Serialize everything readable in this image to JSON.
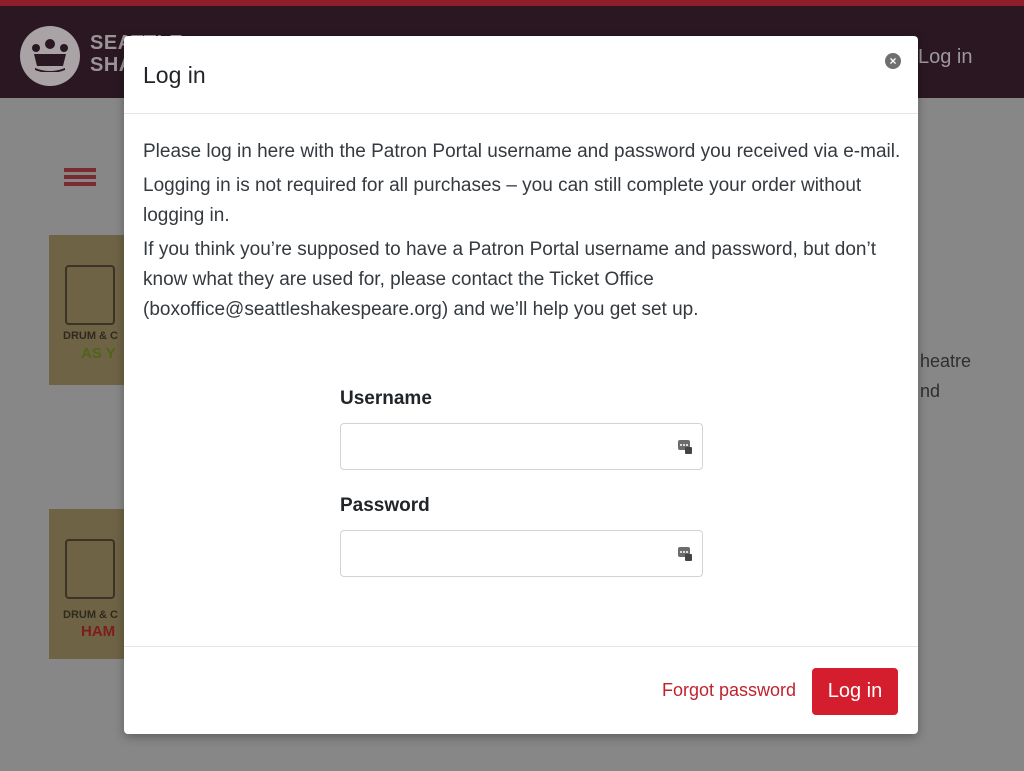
{
  "header": {
    "brand_line1": "SEATTLE",
    "brand_line2": "SHAKESPEARE",
    "login_link": "Log in"
  },
  "background": {
    "posters": [
      {
        "title": "DRUM & C",
        "name": "AS Y",
        "name_color": "#5f7a1e"
      },
      {
        "title": "DRUM & C",
        "name": "HAM",
        "name_color": "#9e2323"
      }
    ],
    "side_text_lines": [
      "heatre",
      "nd"
    ]
  },
  "modal": {
    "title": "Log in",
    "close_icon": "close-icon",
    "paragraphs": [
      "Please log in here with the Patron Portal username and password you received via e-mail.",
      "Logging in is not required for all purchases – you can still complete your order without logging in.",
      "If you think you’re supposed to have a Patron Portal username and password, but don’t know what they are used for, please contact the Ticket Office (boxoffice@seattleshakespeare.org) and we’ll help you get set up."
    ],
    "username_label": "Username",
    "username_value": "",
    "password_label": "Password",
    "password_value": "",
    "forgot_label": "Forgot password",
    "login_button": "Log in"
  },
  "colors": {
    "accent": "#d41e2e",
    "navbar": "#2a1722"
  }
}
